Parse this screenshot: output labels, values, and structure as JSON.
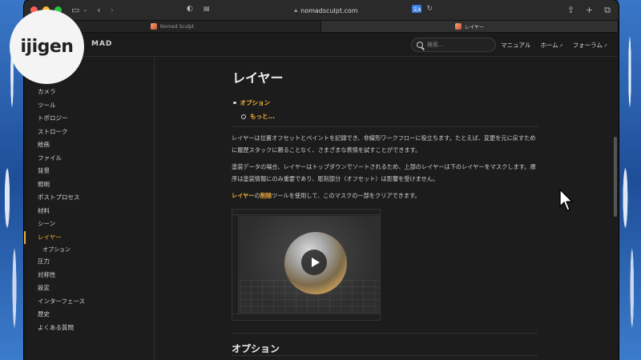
{
  "browser": {
    "url": "nomadsculpt.com",
    "tabs": [
      {
        "label": "Nomad Sculpt",
        "active": false
      },
      {
        "label": "レイヤー",
        "active": true
      }
    ]
  },
  "site": {
    "brand": "MAD",
    "search_placeholder": "検索...",
    "nav": [
      {
        "label": "マニュアル",
        "external": false
      },
      {
        "label": "ホーム",
        "external": true
      },
      {
        "label": "フォーラム",
        "external": true
      }
    ]
  },
  "sidebar": {
    "items": [
      {
        "label": "カメラ"
      },
      {
        "label": "ツール"
      },
      {
        "label": "トポロジー"
      },
      {
        "label": "ストローク"
      },
      {
        "label": "絵画"
      },
      {
        "label": "ファイル"
      },
      {
        "label": "背景"
      },
      {
        "label": "照明"
      },
      {
        "label": "ポストプロセス"
      },
      {
        "label": "材料"
      },
      {
        "label": "シーン"
      },
      {
        "label": "レイヤー",
        "active": true
      },
      {
        "label": "オプション",
        "sub": true
      },
      {
        "label": "圧力"
      },
      {
        "label": "対称性"
      },
      {
        "label": "設定"
      },
      {
        "label": "インターフェース"
      },
      {
        "label": "歴史"
      },
      {
        "label": "よくある質問"
      }
    ]
  },
  "main": {
    "title": "レイヤー",
    "toc": {
      "item1": "オプション",
      "item2": "もっと..."
    },
    "para1": "レイヤーは位置オフセットとペイントを記録でき、非線形ワークフローに役立ちます。たとえば、変更を元に戻すために履歴スタックに頼ることなく、さまざまな表情を試すことができます。",
    "para2": "塗装データの場合、レイヤーはトップダウンでソートされるため、上部のレイヤーは下のレイヤーをマスクします。順序は塗装情報にのみ重要であり、彫刻部分（オフセット）は影響を受けません。",
    "para3_link1": "レイヤー",
    "para3_mid": "の",
    "para3_link2": "削除",
    "para3_end": "ツールを使用して、このマスクの一部をクリアできます。",
    "section_title": "オプション"
  },
  "overlay": {
    "logo_text": "ijigen"
  },
  "colors": {
    "accent": "#f2b13c",
    "background": "#1c1c1c"
  }
}
